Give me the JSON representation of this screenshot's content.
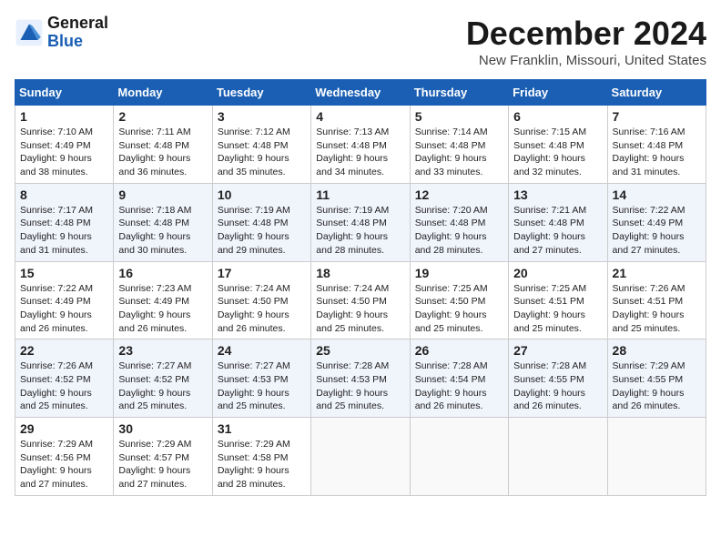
{
  "header": {
    "logo_line1": "General",
    "logo_line2": "Blue",
    "month": "December 2024",
    "location": "New Franklin, Missouri, United States"
  },
  "days_of_week": [
    "Sunday",
    "Monday",
    "Tuesday",
    "Wednesday",
    "Thursday",
    "Friday",
    "Saturday"
  ],
  "weeks": [
    [
      {
        "day": "1",
        "sunrise": "7:10 AM",
        "sunset": "4:49 PM",
        "daylight": "9 hours and 38 minutes."
      },
      {
        "day": "2",
        "sunrise": "7:11 AM",
        "sunset": "4:48 PM",
        "daylight": "9 hours and 36 minutes."
      },
      {
        "day": "3",
        "sunrise": "7:12 AM",
        "sunset": "4:48 PM",
        "daylight": "9 hours and 35 minutes."
      },
      {
        "day": "4",
        "sunrise": "7:13 AM",
        "sunset": "4:48 PM",
        "daylight": "9 hours and 34 minutes."
      },
      {
        "day": "5",
        "sunrise": "7:14 AM",
        "sunset": "4:48 PM",
        "daylight": "9 hours and 33 minutes."
      },
      {
        "day": "6",
        "sunrise": "7:15 AM",
        "sunset": "4:48 PM",
        "daylight": "9 hours and 32 minutes."
      },
      {
        "day": "7",
        "sunrise": "7:16 AM",
        "sunset": "4:48 PM",
        "daylight": "9 hours and 31 minutes."
      }
    ],
    [
      {
        "day": "8",
        "sunrise": "7:17 AM",
        "sunset": "4:48 PM",
        "daylight": "9 hours and 31 minutes."
      },
      {
        "day": "9",
        "sunrise": "7:18 AM",
        "sunset": "4:48 PM",
        "daylight": "9 hours and 30 minutes."
      },
      {
        "day": "10",
        "sunrise": "7:19 AM",
        "sunset": "4:48 PM",
        "daylight": "9 hours and 29 minutes."
      },
      {
        "day": "11",
        "sunrise": "7:19 AM",
        "sunset": "4:48 PM",
        "daylight": "9 hours and 28 minutes."
      },
      {
        "day": "12",
        "sunrise": "7:20 AM",
        "sunset": "4:48 PM",
        "daylight": "9 hours and 28 minutes."
      },
      {
        "day": "13",
        "sunrise": "7:21 AM",
        "sunset": "4:48 PM",
        "daylight": "9 hours and 27 minutes."
      },
      {
        "day": "14",
        "sunrise": "7:22 AM",
        "sunset": "4:49 PM",
        "daylight": "9 hours and 27 minutes."
      }
    ],
    [
      {
        "day": "15",
        "sunrise": "7:22 AM",
        "sunset": "4:49 PM",
        "daylight": "9 hours and 26 minutes."
      },
      {
        "day": "16",
        "sunrise": "7:23 AM",
        "sunset": "4:49 PM",
        "daylight": "9 hours and 26 minutes."
      },
      {
        "day": "17",
        "sunrise": "7:24 AM",
        "sunset": "4:50 PM",
        "daylight": "9 hours and 26 minutes."
      },
      {
        "day": "18",
        "sunrise": "7:24 AM",
        "sunset": "4:50 PM",
        "daylight": "9 hours and 25 minutes."
      },
      {
        "day": "19",
        "sunrise": "7:25 AM",
        "sunset": "4:50 PM",
        "daylight": "9 hours and 25 minutes."
      },
      {
        "day": "20",
        "sunrise": "7:25 AM",
        "sunset": "4:51 PM",
        "daylight": "9 hours and 25 minutes."
      },
      {
        "day": "21",
        "sunrise": "7:26 AM",
        "sunset": "4:51 PM",
        "daylight": "9 hours and 25 minutes."
      }
    ],
    [
      {
        "day": "22",
        "sunrise": "7:26 AM",
        "sunset": "4:52 PM",
        "daylight": "9 hours and 25 minutes."
      },
      {
        "day": "23",
        "sunrise": "7:27 AM",
        "sunset": "4:52 PM",
        "daylight": "9 hours and 25 minutes."
      },
      {
        "day": "24",
        "sunrise": "7:27 AM",
        "sunset": "4:53 PM",
        "daylight": "9 hours and 25 minutes."
      },
      {
        "day": "25",
        "sunrise": "7:28 AM",
        "sunset": "4:53 PM",
        "daylight": "9 hours and 25 minutes."
      },
      {
        "day": "26",
        "sunrise": "7:28 AM",
        "sunset": "4:54 PM",
        "daylight": "9 hours and 26 minutes."
      },
      {
        "day": "27",
        "sunrise": "7:28 AM",
        "sunset": "4:55 PM",
        "daylight": "9 hours and 26 minutes."
      },
      {
        "day": "28",
        "sunrise": "7:29 AM",
        "sunset": "4:55 PM",
        "daylight": "9 hours and 26 minutes."
      }
    ],
    [
      {
        "day": "29",
        "sunrise": "7:29 AM",
        "sunset": "4:56 PM",
        "daylight": "9 hours and 27 minutes."
      },
      {
        "day": "30",
        "sunrise": "7:29 AM",
        "sunset": "4:57 PM",
        "daylight": "9 hours and 27 minutes."
      },
      {
        "day": "31",
        "sunrise": "7:29 AM",
        "sunset": "4:58 PM",
        "daylight": "9 hours and 28 minutes."
      },
      null,
      null,
      null,
      null
    ]
  ]
}
